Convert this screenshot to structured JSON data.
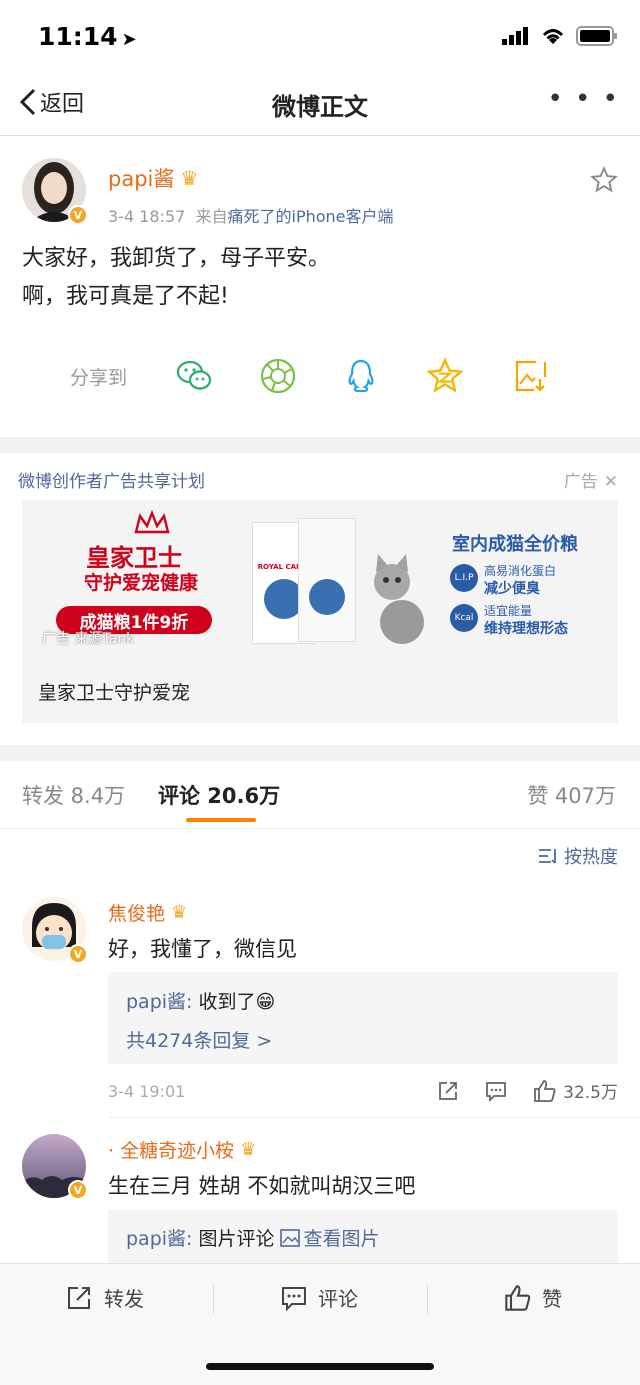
{
  "status": {
    "time": "11:14"
  },
  "nav": {
    "back_label": "返回",
    "title": "微博正文"
  },
  "post": {
    "author": "papi酱",
    "date": "3-4 18:57",
    "source_prefix": "来自",
    "source": "痛死了的iPhone客户端",
    "text_line1": "大家好，我卸货了，母子平安。",
    "text_line2": "啊，我可真是了不起!",
    "share_label": "分享到",
    "share_icons": [
      "wechat-icon",
      "moments-icon",
      "qq-icon",
      "qzone-icon",
      "save-image-icon"
    ]
  },
  "ad": {
    "program": "微博创作者广告共享计划",
    "tag": "广告",
    "caption": "皇家卫士守护爱宠",
    "banner": {
      "headline": "皇家卫士",
      "subheadline": "守护爱宠健康",
      "promo": "成猫粮1件9折",
      "source_note": "广告 来源Tank",
      "brand": "ROYAL CANIN",
      "product_title": "室内成猫全价粮",
      "feature1_small": "高易消化蛋白",
      "feature1": "减少便臭",
      "feature2_small": "适宜能量",
      "feature2": "维持理想形态"
    }
  },
  "tabs": {
    "repost": "转发 8.4万",
    "comments": "评论 20.6万",
    "likes": "赞 407万",
    "sort": "按热度"
  },
  "comments": [
    {
      "name": "焦俊艳",
      "text": "好，我懂了，微信见",
      "reply_author": "papi酱:",
      "reply_text": "收到了😁",
      "reply_count": "共4274条回复 >",
      "time": "3-4 19:01",
      "likes": "32.5万"
    },
    {
      "name": "· 全糖奇迹小桉",
      "text": "生在三月 姓胡 不如就叫胡汉三吧",
      "reply_author": "papi酱:",
      "reply_text": "图片评论",
      "reply_link": "查看图片"
    }
  ],
  "bottom_bar": {
    "repost": "转发",
    "comment": "评论",
    "like": "赞"
  },
  "colors": {
    "brand_orange": "#ff8200",
    "name_orange": "#e86b19",
    "link_blue": "#4e6a98",
    "ad_red": "#d0021b"
  }
}
